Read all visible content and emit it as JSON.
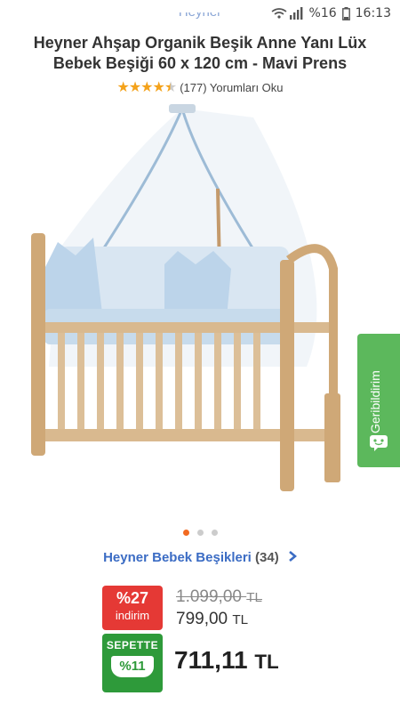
{
  "status_bar": {
    "battery": "%16",
    "time": "16:13",
    "signal_icon": "wifi-signal-icon",
    "battery_icon": "battery-icon"
  },
  "header": {
    "brand": "Heyner"
  },
  "product": {
    "title": "Heyner Ahşap Organik Beşik Anne Yanı Lüx Bebek Beşiği 60 x 120 cm - Mavi Prens",
    "rating": 4.5,
    "stars_display": "★★★★★",
    "reviews": "(177) Yorumları Oku"
  },
  "gallery": {
    "total": 3,
    "active_index": 0
  },
  "feedback": {
    "label": "Geribildirim",
    "color": "#5cb85c"
  },
  "category": {
    "name": "Heyner Bebek Beşikleri",
    "count": "(34)"
  },
  "pricing": {
    "discount_pct": "%27",
    "discount_label": "indirim",
    "old_price": "1.099,00",
    "old_currency": "TL",
    "price": "799,00",
    "price_currency": "TL",
    "basket_label": "SEPETTE",
    "basket_pct": "%11",
    "basket_price": "711,11",
    "basket_currency": "TL"
  },
  "colors": {
    "discount": "#e53935",
    "basket": "#2e9a3a",
    "link": "#3b6cc4",
    "star": "#f4a21a",
    "active_dot": "#f26a21"
  }
}
